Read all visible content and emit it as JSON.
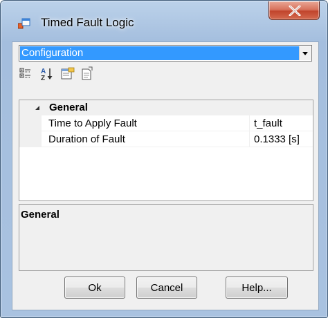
{
  "window": {
    "title": "Timed Fault Logic",
    "close_glyph": "X"
  },
  "combo": {
    "selected": "Configuration"
  },
  "toolbar": {
    "icons": [
      "categorized-icon",
      "alphabetical-icon",
      "property-pages-icon",
      "events-icon"
    ]
  },
  "grid": {
    "category": "General",
    "properties": [
      {
        "name": "Time to Apply Fault",
        "value": "t_fault"
      },
      {
        "name": "Duration of Fault",
        "value": "0.1333 [s]"
      }
    ]
  },
  "help": {
    "title": "General"
  },
  "buttons": {
    "ok": "Ok",
    "cancel": "Cancel",
    "help": "Help..."
  },
  "colors": {
    "selection": "#3399ff",
    "close_button": "#c1452d",
    "frame": "#a9c2e0"
  }
}
